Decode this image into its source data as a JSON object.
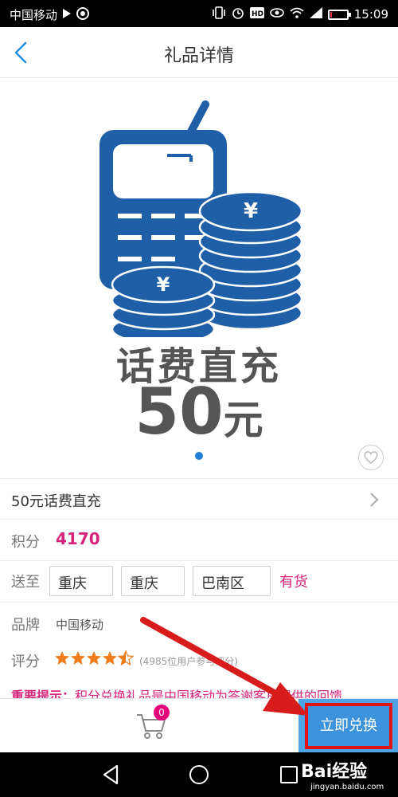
{
  "status_bar": {
    "carrier": "中国移动",
    "time": "15:09",
    "icons": [
      "play-icon",
      "china-mobile-logo-icon",
      "vibrate-icon",
      "alarm-icon",
      "hd-icon",
      "eye-icon",
      "wifi-icon",
      "signal-icon",
      "battery-icon"
    ],
    "battery_level": 0.1
  },
  "header": {
    "title": "礼品详情",
    "back_icon": "chevron-left-icon"
  },
  "product": {
    "image_line1": "话费直充",
    "image_line2_number": "50",
    "image_line2_unit": "元",
    "name": "50元话费直充",
    "gallery_index": 1,
    "gallery_total": 1
  },
  "points": {
    "label": "积分",
    "value": "4170"
  },
  "delivery": {
    "label": "送至",
    "province": "重庆",
    "city": "重庆",
    "district": "巴南区",
    "stock": "有货"
  },
  "brand": {
    "label": "品牌",
    "value": "中国移动"
  },
  "rating": {
    "label": "评分",
    "stars": 4.5,
    "max_stars": 5,
    "count_text": "(4985位用户参与评分)"
  },
  "notice": {
    "label": "重要提示：",
    "text": "积分兑换礼品是中国移动为答谢客户提供的回馈"
  },
  "action_bar": {
    "cart_count": "0",
    "redeem_label": "立即兑换"
  },
  "watermark": {
    "main": "Bai经验",
    "sub": "jingyan.baidu.com"
  },
  "colors": {
    "accent": "#3d93db",
    "highlight": "#d6247a",
    "annotation": "#e11414"
  }
}
